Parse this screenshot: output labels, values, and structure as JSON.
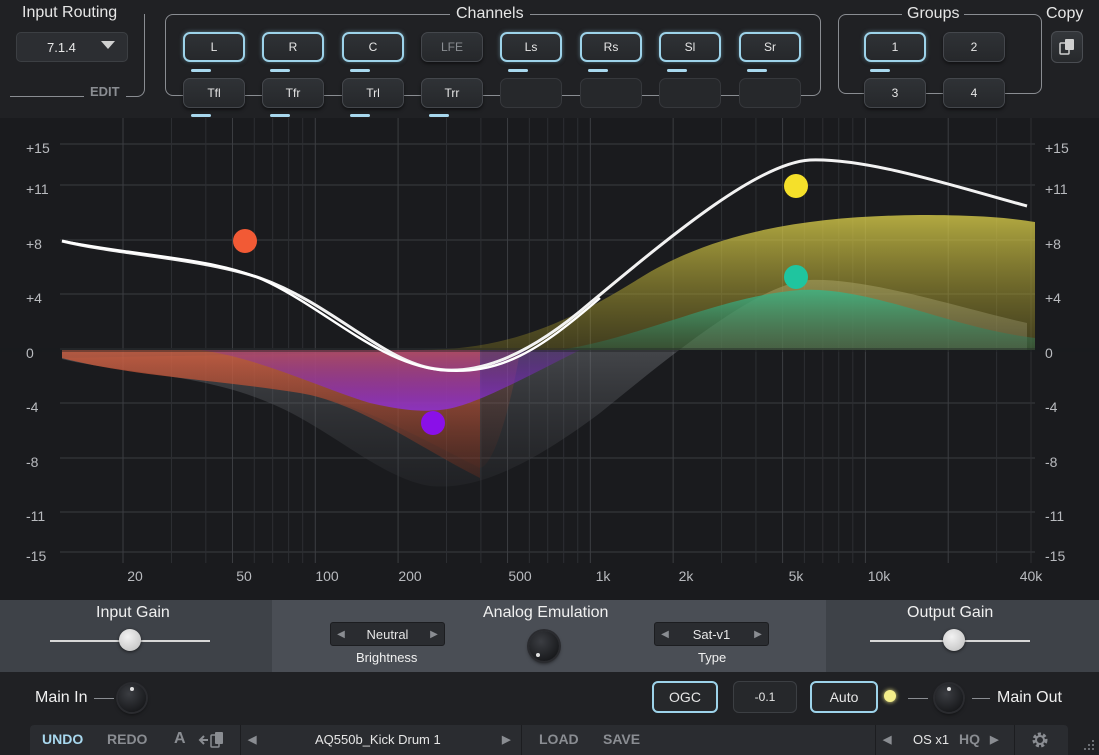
{
  "input_routing": {
    "title": "Input Routing",
    "value": "7.1.4",
    "edit_label": "EDIT"
  },
  "channels": {
    "title": "Channels",
    "row1": [
      {
        "label": "L",
        "on": true
      },
      {
        "label": "R",
        "on": true
      },
      {
        "label": "C",
        "on": true
      },
      {
        "label": "LFE",
        "on": false
      },
      {
        "label": "Ls",
        "on": true
      },
      {
        "label": "Rs",
        "on": true
      },
      {
        "label": "Sl",
        "on": true
      },
      {
        "label": "Sr",
        "on": true
      }
    ],
    "row2": [
      {
        "label": "Tfl"
      },
      {
        "label": "Tfr"
      },
      {
        "label": "Trl"
      },
      {
        "label": "Trr"
      }
    ]
  },
  "groups": {
    "title": "Groups",
    "items": [
      "1",
      "2",
      "3",
      "4"
    ],
    "active": "1"
  },
  "copy": {
    "title": "Copy"
  },
  "eq": {
    "y_ticks": [
      "+15",
      "+11",
      "+8",
      "+4",
      "0",
      "-4",
      "-8",
      "-11",
      "-15"
    ],
    "x_ticks": [
      "20",
      "50",
      "100",
      "200",
      "500",
      "1k",
      "2k",
      "5k",
      "10k",
      "40k"
    ],
    "bands": [
      {
        "color": "#f25a35",
        "name": "band-1"
      },
      {
        "color": "#8a10e8",
        "name": "band-2"
      },
      {
        "color": "#f5e02a",
        "name": "band-3"
      },
      {
        "color": "#1fc59f",
        "name": "band-4"
      }
    ]
  },
  "input_gain": {
    "label": "Input Gain",
    "level": 0.5
  },
  "analog_emulation": {
    "label": "Analog Emulation",
    "brightness_value": "Neutral",
    "brightness_label": "Brightness",
    "type_value": "Sat-v1",
    "type_label": "Type"
  },
  "output_gain": {
    "label": "Output Gain",
    "level": 0.53
  },
  "bottom": {
    "main_in": "Main In",
    "ogc": "OGC",
    "ogc_value": "-0.1",
    "auto": "Auto",
    "main_out": "Main Out"
  },
  "toolbar": {
    "undo": "UNDO",
    "redo": "REDO",
    "ab": "A",
    "preset": "AQ550b_Kick Drum 1",
    "load": "LOAD",
    "save": "SAVE",
    "os": "OS x1",
    "hq": "HQ"
  }
}
